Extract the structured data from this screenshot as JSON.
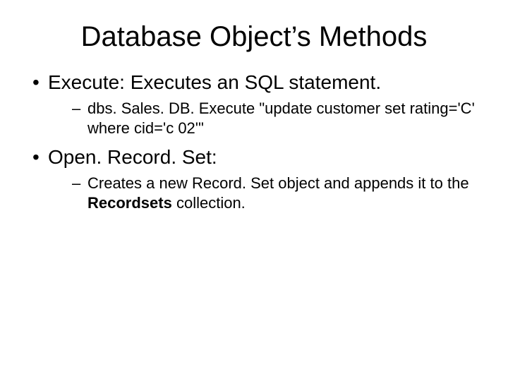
{
  "title": "Database Object’s Methods",
  "bullets": [
    {
      "text": "Execute: Executes an SQL statement.",
      "sub": [
        {
          "text": "dbs. Sales. DB. Execute \"update customer set rating='C' where cid='c 02'\""
        }
      ]
    },
    {
      "text": "Open. Record. Set:",
      "sub": [
        {
          "prefix": "Creates a new Record. Set object and appends it to the ",
          "bold": "Recordsets",
          "suffix": " collection."
        }
      ]
    }
  ]
}
